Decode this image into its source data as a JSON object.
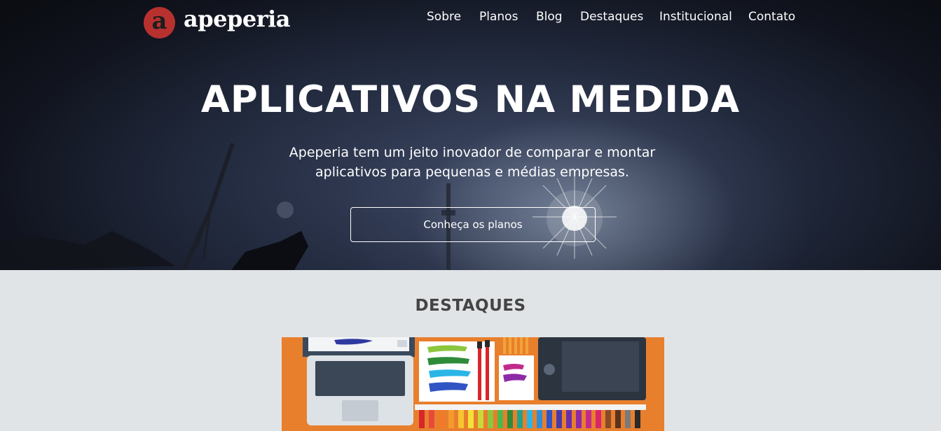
{
  "brand": {
    "mark": "a",
    "name": "apeperia",
    "color": "#b8312f"
  },
  "nav": {
    "links": [
      {
        "label": "Sobre"
      },
      {
        "label": "Planos"
      },
      {
        "label": "Blog"
      },
      {
        "label": "Destaques"
      },
      {
        "label": "Institucional"
      },
      {
        "label": "Contato"
      }
    ]
  },
  "hero": {
    "title": "APLICATIVOS NA MEDIDA",
    "subtitle": "Apeperia tem um jeito inovador de comparar e montar aplicativos para pequenas e médias empresas.",
    "cta_label": "Conheça os planos"
  },
  "highlights": {
    "title": "DESTAQUES",
    "image_background": "#e87f2d"
  }
}
